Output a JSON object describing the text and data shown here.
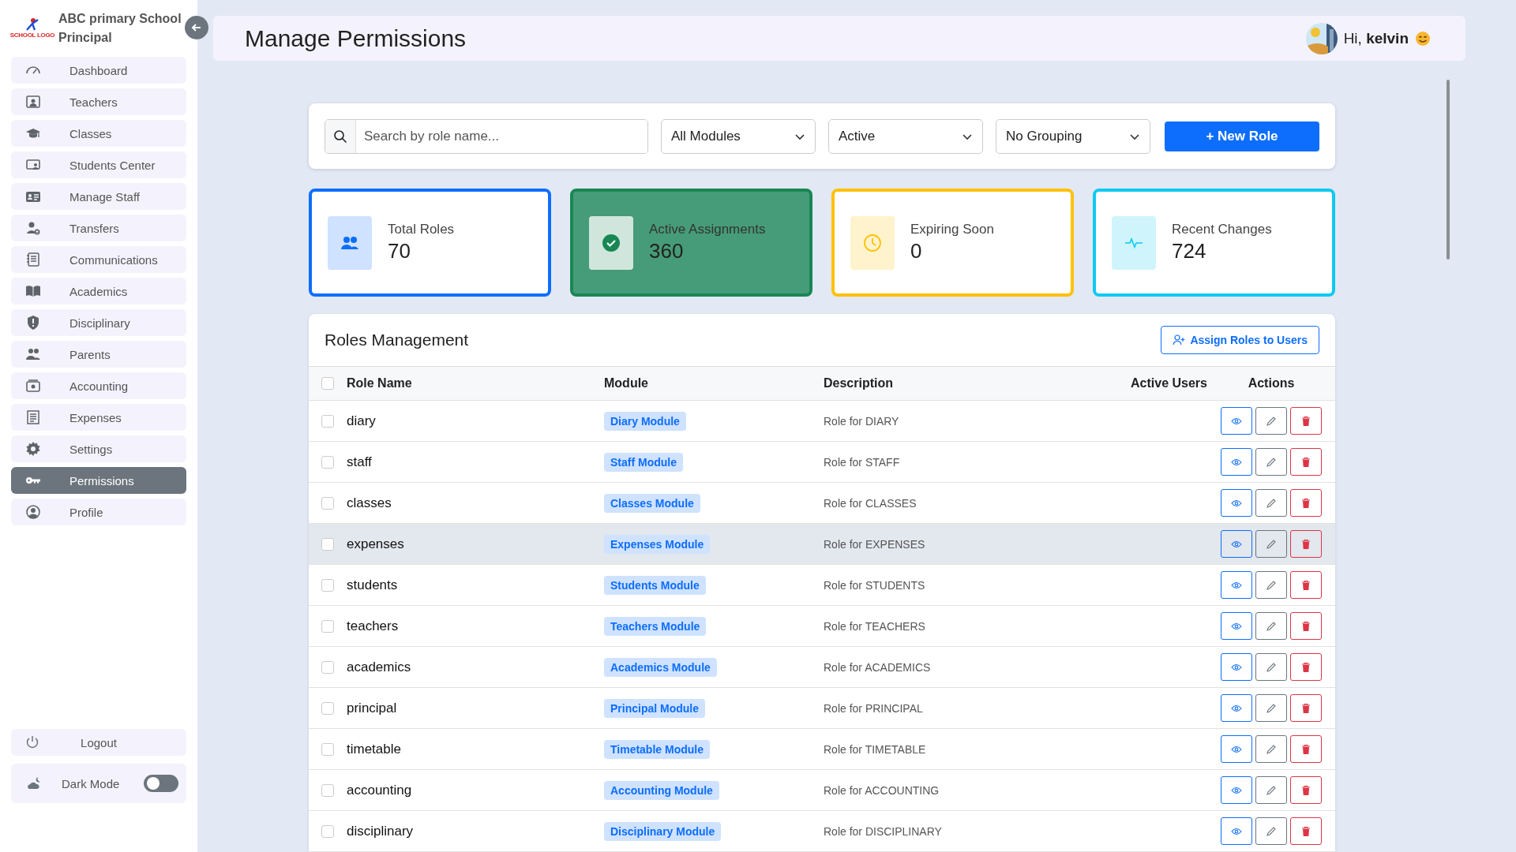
{
  "sidebar": {
    "school_name": "ABC primary School",
    "role": "Principal",
    "logo_text": "SCHOOL LOGO",
    "items": [
      {
        "label": "Dashboard",
        "selected": false
      },
      {
        "label": "Teachers",
        "selected": false
      },
      {
        "label": "Classes",
        "selected": false
      },
      {
        "label": "Students Center",
        "selected": false
      },
      {
        "label": "Manage Staff",
        "selected": false
      },
      {
        "label": "Transfers",
        "selected": false
      },
      {
        "label": "Communications",
        "selected": false
      },
      {
        "label": "Academics",
        "selected": false
      },
      {
        "label": "Disciplinary",
        "selected": false
      },
      {
        "label": "Parents",
        "selected": false
      },
      {
        "label": "Accounting",
        "selected": false
      },
      {
        "label": "Expenses",
        "selected": false
      },
      {
        "label": "Settings",
        "selected": false
      },
      {
        "label": "Permissions",
        "selected": true
      },
      {
        "label": "Profile",
        "selected": false
      }
    ],
    "logout": "Logout",
    "dark_mode": {
      "label": "Dark Mode",
      "on": false
    }
  },
  "header": {
    "title": "Manage Permissions",
    "greeting": "Hi, **kelvin**"
  },
  "filters": {
    "search": {
      "placeholder": "Search by role name..."
    },
    "module": "All Modules",
    "status": "Active",
    "grouping": "No Grouping",
    "new_button": "+ New Role"
  },
  "stats": [
    {
      "label": "Total Roles",
      "value": "70",
      "color": "#0d6efd",
      "filled": false
    },
    {
      "label": "Active Assignments",
      "value": "360",
      "color": "#198754",
      "filled": true
    },
    {
      "label": "Expiring Soon",
      "value": "0",
      "color": "#ffc107",
      "filled": false
    },
    {
      "label": "Recent Changes",
      "value": "724",
      "color": "#0dcaf0",
      "filled": false
    }
  ],
  "roles": {
    "title": "Roles Management",
    "assign_button": "Assign Roles to Users",
    "all_checked": false,
    "columns": [
      "Role Name",
      "Module",
      "Description",
      "Active Users",
      "Actions"
    ],
    "rows": [
      {
        "name": "diary",
        "module": "Diary Module",
        "description": "Role for DIARY",
        "checked": false,
        "highlighted": false
      },
      {
        "name": "staff",
        "module": "Staff Module",
        "description": "Role for STAFF",
        "checked": false,
        "highlighted": false
      },
      {
        "name": "classes",
        "module": "Classes Module",
        "description": "Role for CLASSES",
        "checked": false,
        "highlighted": false
      },
      {
        "name": "expenses",
        "module": "Expenses Module",
        "description": "Role for EXPENSES",
        "checked": false,
        "highlighted": true
      },
      {
        "name": "students",
        "module": "Students Module",
        "description": "Role for STUDENTS",
        "checked": false,
        "highlighted": false
      },
      {
        "name": "teachers",
        "module": "Teachers Module",
        "description": "Role for TEACHERS",
        "checked": false,
        "highlighted": false
      },
      {
        "name": "academics",
        "module": "Academics Module",
        "description": "Role for ACADEMICS",
        "checked": false,
        "highlighted": false
      },
      {
        "name": "principal",
        "module": "Principal Module",
        "description": "Role for PRINCIPAL",
        "checked": false,
        "highlighted": false
      },
      {
        "name": "timetable",
        "module": "Timetable Module",
        "description": "Role for TIMETABLE",
        "checked": false,
        "highlighted": false
      },
      {
        "name": "accounting",
        "module": "Accounting Module",
        "description": "Role for ACCOUNTING",
        "checked": false,
        "highlighted": false
      },
      {
        "name": "disciplinary",
        "module": "Disciplinary Module",
        "description": "Role for DISCIPLINARY",
        "checked": false,
        "highlighted": false
      }
    ]
  }
}
